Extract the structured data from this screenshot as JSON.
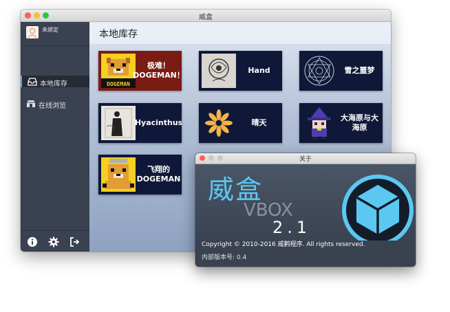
{
  "window": {
    "title": "威盒"
  },
  "sidebar": {
    "user": {
      "name": "未绑定"
    },
    "items": [
      {
        "label": "本地库存",
        "icon": "inbox-icon",
        "active": true
      },
      {
        "label": "在线浏览",
        "icon": "store-icon",
        "active": false
      }
    ],
    "bottom_icons": [
      "info-icon",
      "gear-icon",
      "logout-icon"
    ]
  },
  "main": {
    "title": "本地库存",
    "games": [
      {
        "name": "极难！DOGEMAN！",
        "thumb": "dogeman-pixel-art"
      },
      {
        "name": "Hand",
        "thumb": "hand-sketch"
      },
      {
        "name": "雪之噩梦",
        "thumb": "magic-circle"
      },
      {
        "name": "Hyacinthus",
        "thumb": "silhouette-figure"
      },
      {
        "name": "晴天",
        "thumb": "sunflower"
      },
      {
        "name": "大海原与大海原",
        "thumb": "witch-pixel-art"
      },
      {
        "name": "飞翔的DOGEMAN",
        "thumb": "dogeman-pixel-art"
      }
    ]
  },
  "about": {
    "title": "关于",
    "brand_cn": "威盒",
    "brand_en": "VBOX",
    "version": "2.1",
    "copyright": "Copyright © 2010-2016 威鹳程序. All rights reserved.",
    "build": "内部版本号: 0.4"
  },
  "colors": {
    "accent": "#5bc8f2",
    "sidebar_bg": "#3a4150",
    "tile_bg": "#0f1838"
  }
}
